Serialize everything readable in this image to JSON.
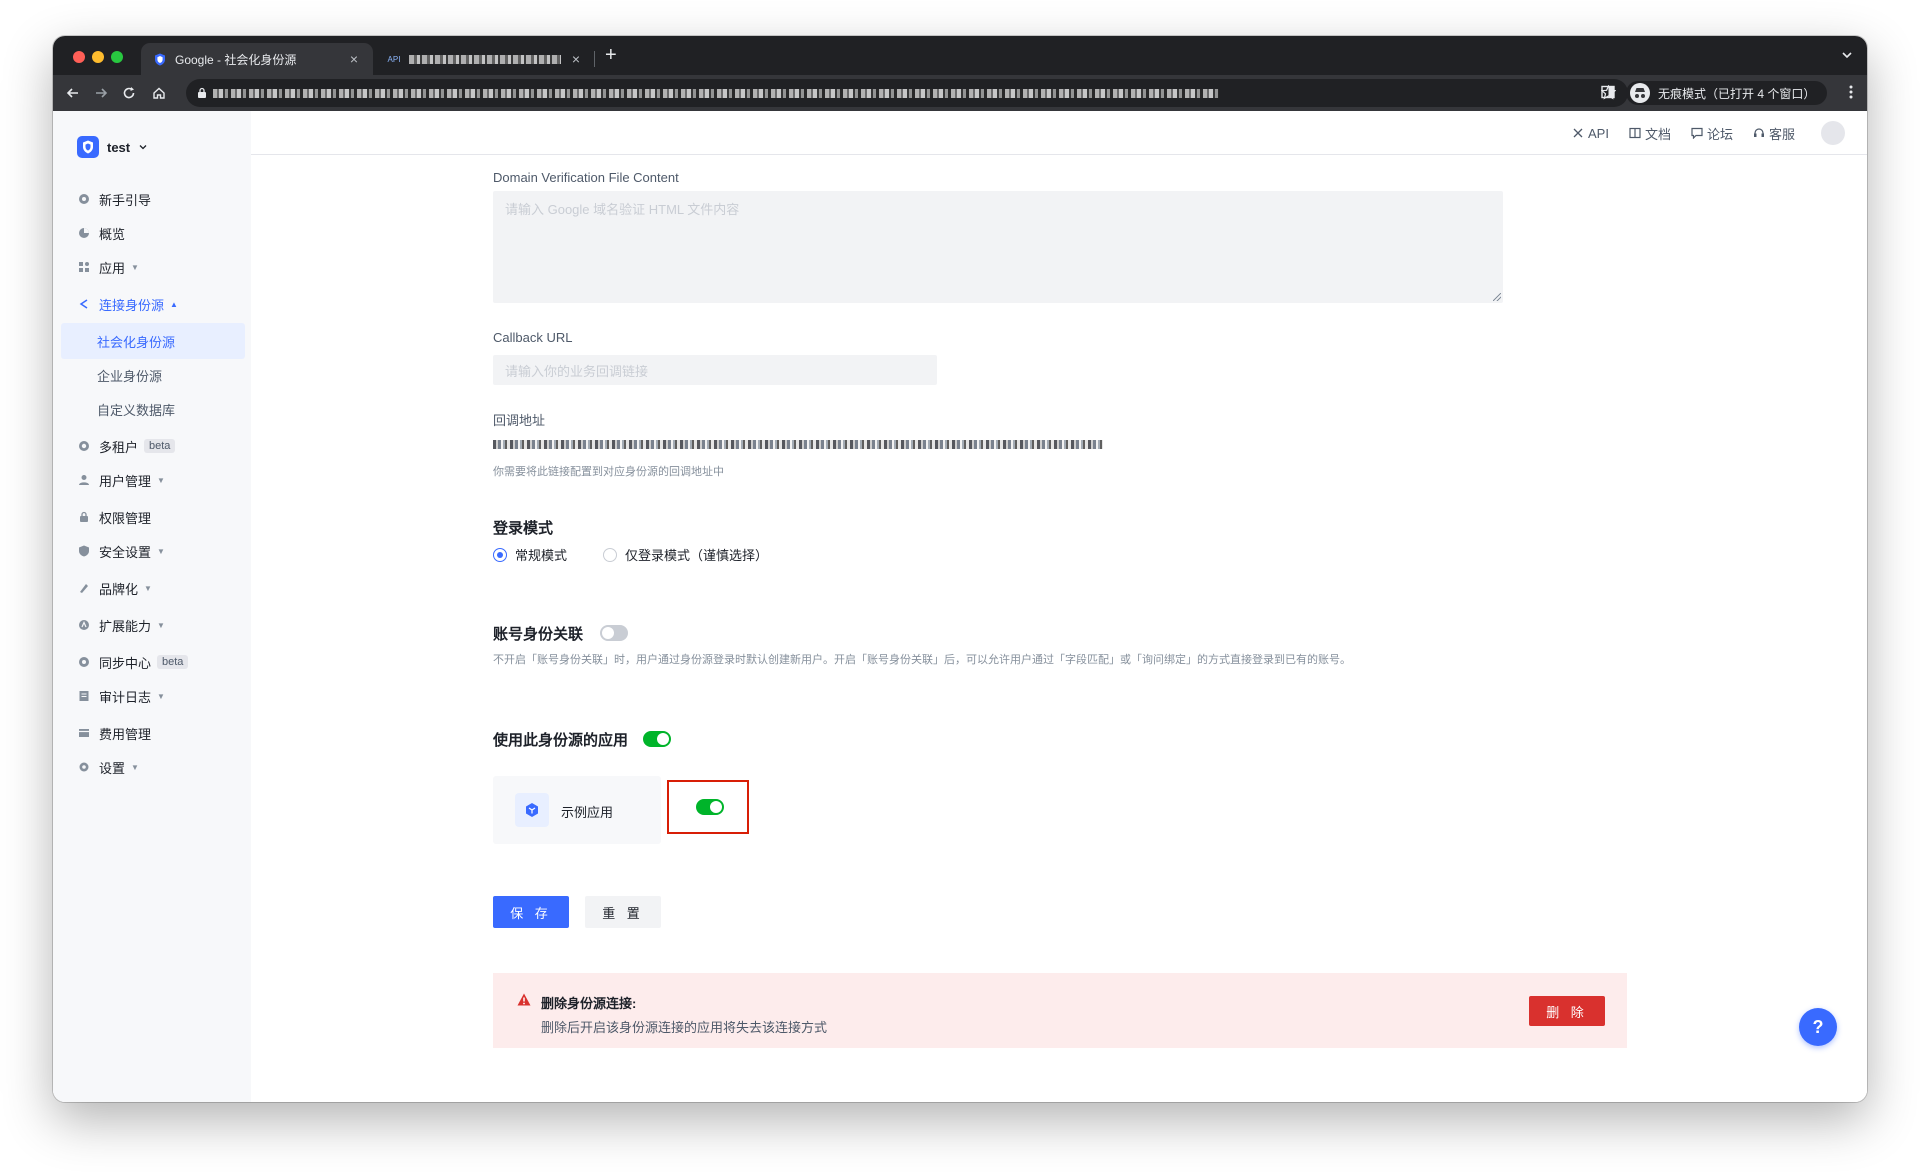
{
  "browser": {
    "tabs": [
      {
        "title": "Google - 社会化身份源",
        "active": true
      },
      {
        "title": "",
        "active": false
      }
    ],
    "incognito_label": "无痕模式（已打开 4 个窗口）"
  },
  "sidebar": {
    "tenant_name": "test",
    "items": [
      {
        "label": "新手引导",
        "icon": "guide-icon"
      },
      {
        "label": "概览",
        "icon": "pie-chart-icon"
      },
      {
        "label": "应用",
        "icon": "apps-icon",
        "expandable": true
      },
      {
        "label": "连接身份源",
        "icon": "connection-icon",
        "expandable": true,
        "open": true
      },
      {
        "label": "多租户",
        "icon": "tenant-icon",
        "badge": "beta"
      },
      {
        "label": "用户管理",
        "icon": "users-icon",
        "expandable": true
      },
      {
        "label": "权限管理",
        "icon": "lock-icon"
      },
      {
        "label": "安全设置",
        "icon": "shield-icon",
        "expandable": true
      },
      {
        "label": "品牌化",
        "icon": "brush-icon",
        "expandable": true
      },
      {
        "label": "扩展能力",
        "icon": "extension-icon",
        "expandable": true
      },
      {
        "label": "同步中心",
        "icon": "sync-icon",
        "badge": "beta"
      },
      {
        "label": "审计日志",
        "icon": "log-icon",
        "expandable": true
      },
      {
        "label": "费用管理",
        "icon": "billing-icon"
      },
      {
        "label": "设置",
        "icon": "gear-icon",
        "expandable": true
      }
    ],
    "submenu": [
      {
        "label": "社会化身份源",
        "active": true
      },
      {
        "label": "企业身份源",
        "active": false
      },
      {
        "label": "自定义数据库",
        "active": false
      }
    ]
  },
  "topnav": {
    "links": [
      {
        "label": "API",
        "icon": "api-icon"
      },
      {
        "label": "文档",
        "icon": "book-icon"
      },
      {
        "label": "论坛",
        "icon": "forum-icon"
      },
      {
        "label": "客服",
        "icon": "headset-icon"
      }
    ]
  },
  "form": {
    "verification_label": "Domain Verification File Content",
    "verification_placeholder": "请输入 Google 域名验证 HTML 文件内容",
    "callback_url_label": "Callback URL",
    "callback_url_placeholder": "请输入你的业务回调链接",
    "callback_address_label": "回调地址",
    "callback_address_hint": "你需要将此链接配置到对应身份源的回调地址中",
    "login_mode_title": "登录模式",
    "login_modes": [
      {
        "label": "常规模式",
        "checked": true
      },
      {
        "label": "仅登录模式（谨慎选择）",
        "checked": false
      }
    ],
    "account_link_title": "账号身份关联",
    "account_link_enabled": false,
    "account_link_desc": "不开启「账号身份关联」时，用户通过身份源登录时默认创建新用户。开启「账号身份关联」后，可以允许用户通过「字段匹配」或「询问绑定」的方式直接登录到已有的账号。",
    "apps_title": "使用此身份源的应用",
    "apps_enabled": true,
    "app_card": {
      "name": "示例应用",
      "enabled": true
    },
    "save_label": "保 存",
    "reset_label": "重 置"
  },
  "danger": {
    "title": "删除身份源连接:",
    "description": "删除后开启该身份源连接的应用将失去该连接方式",
    "delete_label": "删 除"
  },
  "help_label": "?",
  "colors": {
    "primary": "#396aff",
    "success": "#00b42a",
    "danger": "#d9312e",
    "highlight": "#d81e06"
  }
}
